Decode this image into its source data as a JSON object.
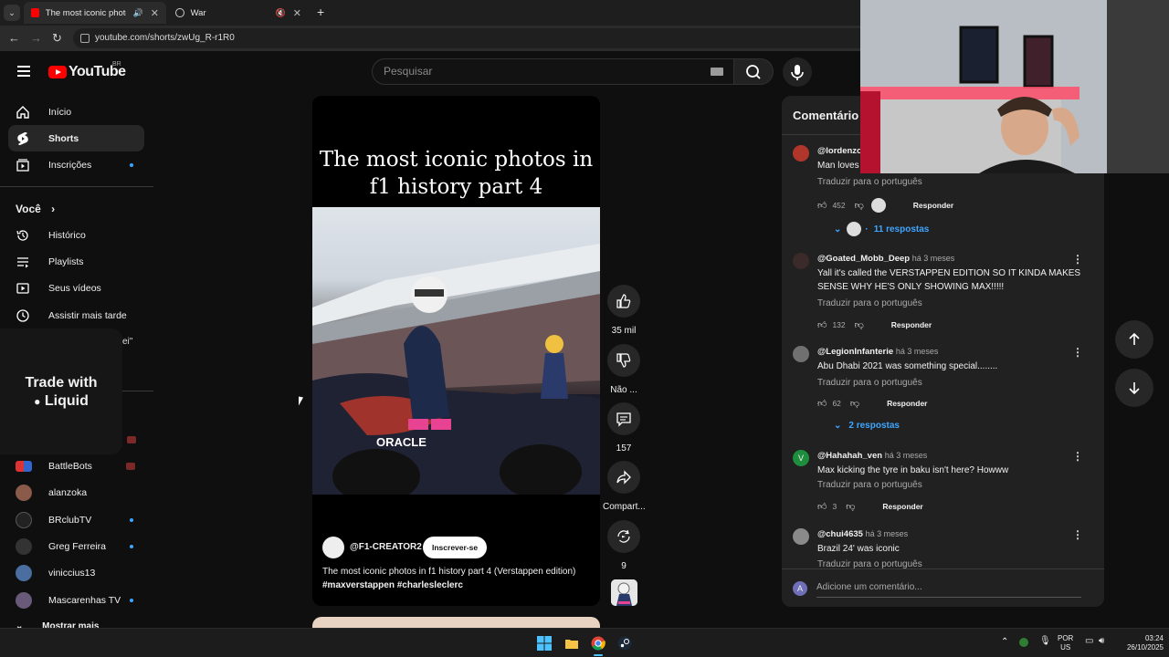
{
  "browser": {
    "tabs": [
      {
        "title": "The most iconic photos in f",
        "active": true
      },
      {
        "title": "War",
        "active": false
      }
    ],
    "new_tab_symbol": "+",
    "url": "youtube.com/shorts/zwUg_R-r1R0"
  },
  "youtube": {
    "logo_text": "YouTube",
    "country_code": "BR",
    "search_placeholder": "Pesquisar"
  },
  "sidebar": {
    "main_items": [
      {
        "label": "Início",
        "icon": "home-icon"
      },
      {
        "label": "Shorts",
        "icon": "shorts-icon",
        "active": true
      },
      {
        "label": "Inscrições",
        "icon": "subscriptions-icon",
        "dot": true
      }
    ],
    "you_title": "Você",
    "you_items": [
      {
        "label": "Histórico",
        "icon": "history-icon"
      },
      {
        "label": "Playlists",
        "icon": "playlists-icon"
      },
      {
        "label": "Seus vídeos",
        "icon": "your-videos-icon"
      },
      {
        "label": "Assistir mais tarde",
        "icon": "watch-later-icon"
      }
    ],
    "cut_label": "ei\"",
    "channels": [
      {
        "name": "BattleBots",
        "live": true
      },
      {
        "name": "alanzoka"
      },
      {
        "name": "BRclubTV",
        "dot": true
      },
      {
        "name": "Greg Ferreira",
        "dot": true
      },
      {
        "name": "viniccius13"
      },
      {
        "name": "Mascarenhas TV",
        "dot": true
      }
    ],
    "show_more": "Mostrar mais",
    "ad_text_line1": "Trade with",
    "ad_text_line2": "Liquid"
  },
  "short": {
    "title_line1": "The most iconic photos in",
    "title_line2": "f1 history part 4",
    "channel": "@F1-CREATOR2",
    "subscribe_label": "Inscrever-se",
    "description": "The most iconic photos in f1 history part 4 (Verstappen edition)",
    "tags": "#maxverstappen  #charlesleclerc",
    "actions": {
      "likes": "35 mil",
      "dislike": "Não ...",
      "comments": "157",
      "share": "Compart...",
      "remix": "9"
    }
  },
  "comments": {
    "header": "Comentário",
    "items": [
      {
        "user": "@lordenzo",
        "time": "",
        "text": "Man loves ma",
        "translate": "Traduzir para o português",
        "likes": "452",
        "reply": "Responder",
        "replies": "11 respostas",
        "avatar_color": "#b0362c"
      },
      {
        "user": "@Goated_Mobb_Deep",
        "time": "há 3 meses",
        "text": "Yall it's called the VERSTAPPEN EDITION SO IT KINDA MAKES SENSE WHY HE'S ONLY SHOWING MAX!!!!!",
        "translate": "Traduzir para o português",
        "likes": "132",
        "reply": "Responder",
        "avatar_color": "#3a2a2a"
      },
      {
        "user": "@LegionInfanterie",
        "time": "há 3 meses",
        "text": "Abu Dhabi 2021 was something special........",
        "translate": "Traduzir para o português",
        "likes": "62",
        "reply": "Responder",
        "replies": "2 respostas",
        "avatar_color": "#707070"
      },
      {
        "user": "@Hahahah_ven",
        "time": "há 3 meses",
        "text": "Max kicking the tyre in baku isn't here? Howww",
        "translate": "Traduzir para o português",
        "likes": "3",
        "reply": "Responder",
        "avatar_color": "#1e8e3e",
        "avatar_letter": "V"
      },
      {
        "user": "@chui4635",
        "time": "há 3 meses",
        "text": "Brazil 24' was iconic",
        "translate": "Traduzir para o português",
        "avatar_color": "#8a8a8a"
      }
    ],
    "add_placeholder": "Adicione um comentário...",
    "me_initial": "A"
  },
  "taskbar": {
    "lang_line1": "POR",
    "lang_line2": "US",
    "time": "03:24",
    "date": "26/10/2025"
  },
  "colors": {
    "accent_blue": "#3ea6ff",
    "yt_red": "#ff0000",
    "background": "#0f0f0f"
  }
}
